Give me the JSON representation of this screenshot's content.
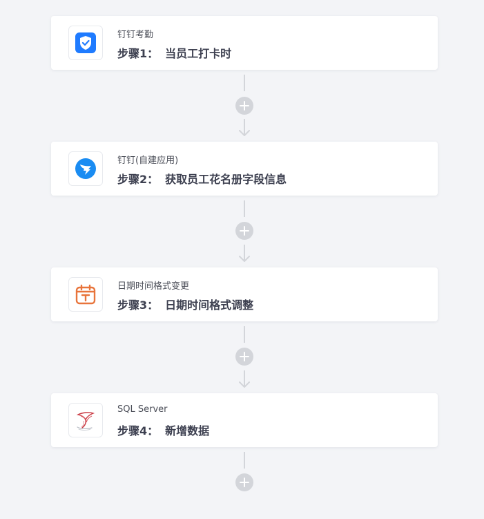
{
  "steps": [
    {
      "app": "钉钉考勤",
      "label": "步骤1：",
      "title": "当员工打卡时",
      "icon": "dingtalk-attendance-icon",
      "color": "#1f7bff"
    },
    {
      "app": "钉钉(自建应用)",
      "label": "步骤2：",
      "title": "获取员工花名册字段信息",
      "icon": "dingtalk-app-icon",
      "color": "#1a8cf2"
    },
    {
      "app": "日期时间格式变更",
      "label": "步骤3：",
      "title": "日期时间格式调整",
      "icon": "calendar-icon",
      "color": "#e8743b"
    },
    {
      "app": "SQL Server",
      "label": "步骤4：",
      "title": "新增数据",
      "icon": "sql-server-icon",
      "color": "#c9363f"
    }
  ]
}
